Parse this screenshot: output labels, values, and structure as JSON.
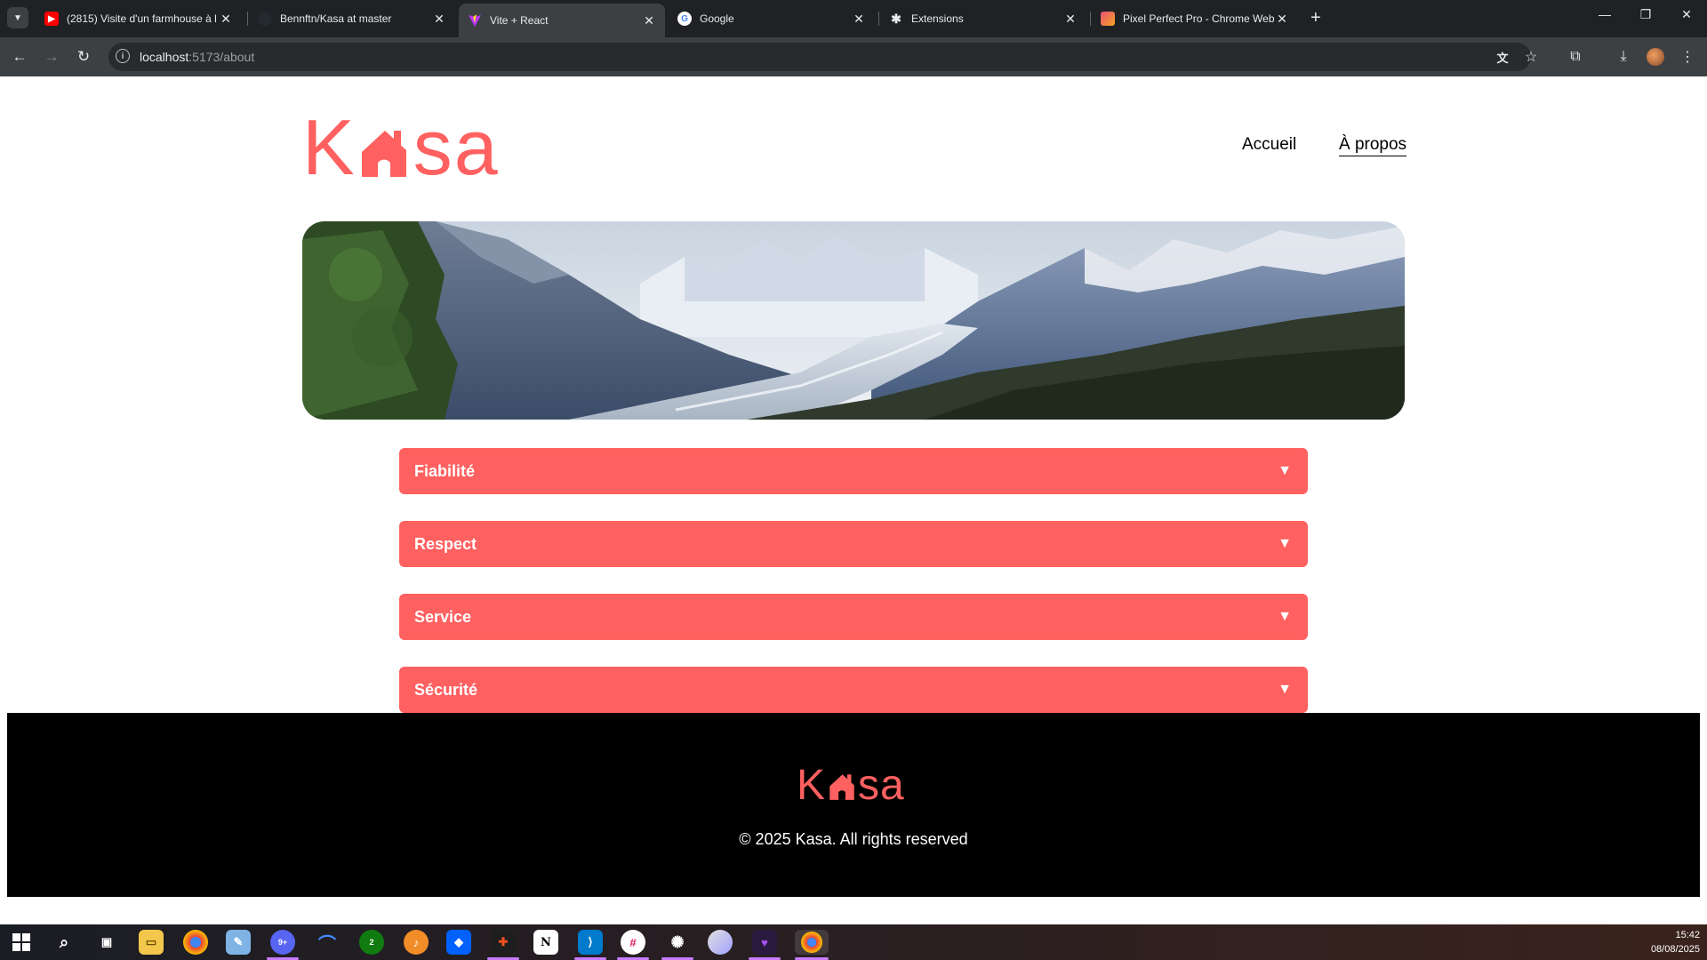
{
  "browser": {
    "tabs": [
      {
        "title": "(2815) Visite d'un farmhouse à l",
        "icon": "youtube-icon"
      },
      {
        "title": "Bennftn/Kasa at master",
        "icon": "github-icon"
      },
      {
        "title": "Vite + React",
        "icon": "vite-icon"
      },
      {
        "title": "Google",
        "icon": "google-icon"
      },
      {
        "title": "Extensions",
        "icon": "puzzle-icon"
      },
      {
        "title": "Pixel Perfect Pro - Chrome Web",
        "icon": "pixel-perfect-icon"
      }
    ],
    "url_host": "localhost",
    "url_path": ":5173/about"
  },
  "site": {
    "logo": {
      "left": "K",
      "right": "sa"
    },
    "nav": {
      "home": "Accueil",
      "about": "À propos"
    },
    "accent": "#ff6060",
    "collapses": [
      {
        "label": "Fiabilité"
      },
      {
        "label": "Respect"
      },
      {
        "label": "Service"
      },
      {
        "label": "Sécurité"
      }
    ],
    "footer": {
      "copyright": "© 2025 Kasa. All rights reserved"
    }
  },
  "taskbar": {
    "apps": [
      "windows-start-icon",
      "search-icon",
      "task-view-icon",
      "file-explorer-icon",
      "chrome-icon",
      "notepad-icon",
      "discord-icon",
      "nordvpn-icon",
      "xbox-icon",
      "fl-studio-icon",
      "dropbox-icon",
      "figma-icon",
      "notion-icon",
      "vscode-icon",
      "slack-icon",
      "chatgpt-icon",
      "paint-icon",
      "obsidian-icon",
      "chrome-active-icon"
    ],
    "discord_badge": "9+",
    "xbox_badge": "2",
    "time": "15:42",
    "date": "08/08/2025"
  }
}
